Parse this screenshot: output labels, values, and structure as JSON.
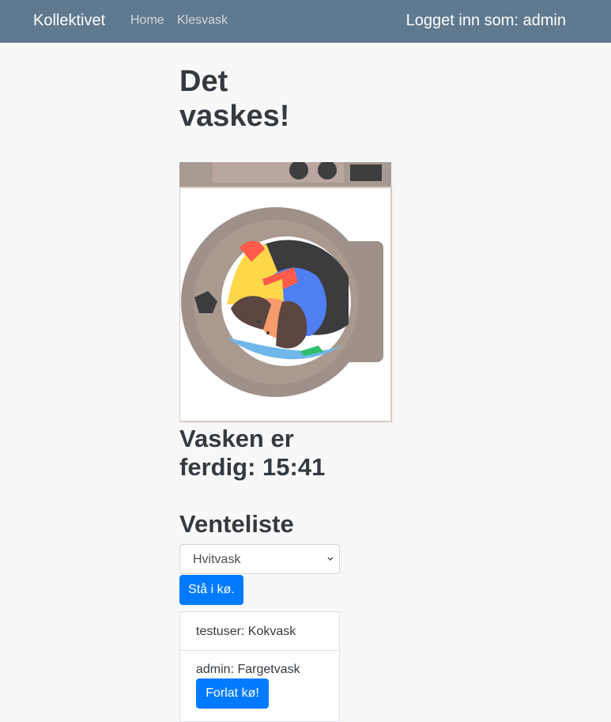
{
  "nav": {
    "brand": "Kollektivet",
    "links": [
      "Home",
      "Klesvask"
    ],
    "login_text": "Logget inn som: admin"
  },
  "main": {
    "title": "Det vaskes!",
    "status_text": "Vasken er ferdig: 15:41",
    "queue_title": "Venteliste",
    "select_value": "Hvitvask",
    "queue_button": "Stå i kø.",
    "queue_items": [
      {
        "text": "testuser: Kokvask"
      },
      {
        "text": "admin: Fargetvask",
        "button": "Forlat kø!"
      }
    ]
  },
  "colors": {
    "navbar": "#5f798f",
    "background": "#f8f8f8",
    "button": "#007bff",
    "text": "#343a40"
  }
}
